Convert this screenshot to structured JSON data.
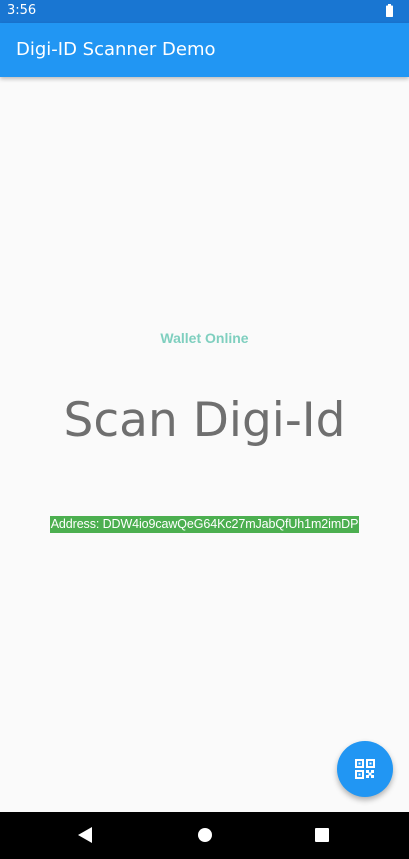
{
  "status_bar": {
    "time": "3:56",
    "battery_icon": "battery-icon",
    "color": "#1976d2"
  },
  "app_bar": {
    "title": "Digi-ID Scanner Demo",
    "color": "#2196f3"
  },
  "main": {
    "wallet_status": "Wallet Online",
    "wallet_status_color": "#7fcfbf",
    "scan_title": "Scan Digi-Id",
    "scan_title_color": "#6f6f6f",
    "address": "Address: DDW4io9cawQeG64Kc27mJabQfUh1m2imDP",
    "address_background": "#4caf50"
  },
  "fab": {
    "icon": "qr-code-icon",
    "color": "#2196f3"
  },
  "nav_bar": {
    "back_icon": "back-icon",
    "home_icon": "home-icon",
    "recents_icon": "recents-icon"
  }
}
